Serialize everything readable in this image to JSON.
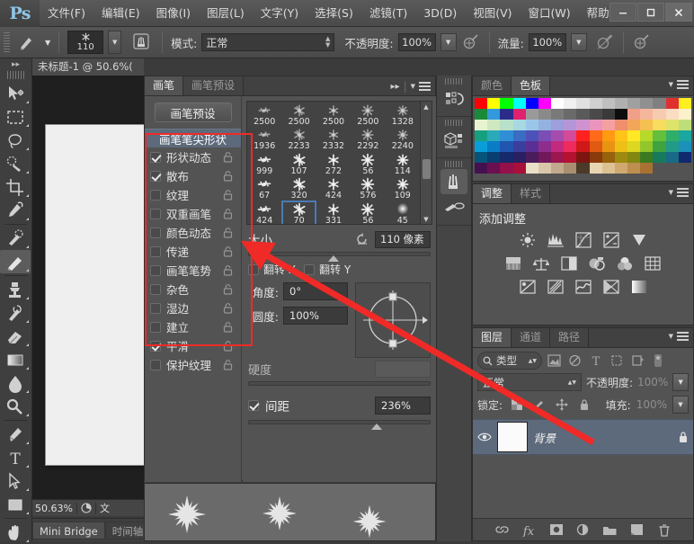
{
  "app": {
    "logo": "Ps",
    "menus": [
      "文件(F)",
      "编辑(E)",
      "图像(I)",
      "图层(L)",
      "文字(Y)",
      "选择(S)",
      "滤镜(T)",
      "3D(D)",
      "视图(V)",
      "窗口(W)",
      "帮助(H)"
    ],
    "window_buttons": {
      "minimize": "—",
      "maximize": "▢",
      "close": "✕"
    }
  },
  "options_bar": {
    "brush_preset_icon": "brush-preset-icon",
    "brush_size_value": "110",
    "airbrush_toggle_icon": "airbrush-toggle-icon",
    "mode_label": "模式:",
    "mode_value": "正常",
    "opacity_label": "不透明度:",
    "opacity_value": "100%",
    "opacity_pressure_icon": "opacity-pressure-icon",
    "flow_label": "流量:",
    "flow_value": "100%",
    "airbrush_icon": "airbrush-icon",
    "flow_pressure_icon": "flow-pressure-icon"
  },
  "toolbar": {
    "expand_icon": "double-chevron-right-icon",
    "tools": [
      {
        "name": "move-tool",
        "selected": false
      },
      {
        "name": "rectangular-marquee-tool",
        "selected": false
      },
      {
        "name": "lasso-tool",
        "selected": false
      },
      {
        "name": "quick-selection-tool",
        "selected": false
      },
      {
        "name": "crop-tool",
        "selected": false
      },
      {
        "name": "eyedropper-tool",
        "selected": false
      },
      {
        "name": "spot-healing-brush-tool",
        "selected": false
      },
      {
        "name": "brush-tool",
        "selected": true
      },
      {
        "name": "clone-stamp-tool",
        "selected": false
      },
      {
        "name": "history-brush-tool",
        "selected": false
      },
      {
        "name": "eraser-tool",
        "selected": false
      },
      {
        "name": "gradient-tool",
        "selected": false
      },
      {
        "name": "blur-tool",
        "selected": false
      },
      {
        "name": "dodge-tool",
        "selected": false
      },
      {
        "name": "pen-tool",
        "selected": false
      },
      {
        "name": "type-tool",
        "selected": false
      },
      {
        "name": "path-selection-tool",
        "selected": false
      },
      {
        "name": "rectangle-tool",
        "selected": false
      },
      {
        "name": "hand-tool",
        "selected": false
      }
    ]
  },
  "document": {
    "tab_title": "未标题-1 @ 50.6%(",
    "zoom_status": "50.63%",
    "doc_info": "文"
  },
  "bottom_tabs": [
    {
      "label": "Mini Bridge",
      "active": true
    },
    {
      "label": "时间轴",
      "active": false
    }
  ],
  "brush_panel": {
    "tabs": [
      {
        "label": "画笔",
        "active": true
      },
      {
        "label": "画笔预设",
        "active": false
      }
    ],
    "collapse_icon": "double-chevron-right-icon",
    "menu_icon": "panel-menu-icon",
    "preset_button": "画笔预设",
    "tip_shape_row": "画笔笔尖形状",
    "options": [
      {
        "label": "形状动态",
        "checked": true,
        "lock": "lock-icon"
      },
      {
        "label": "散布",
        "checked": true,
        "lock": "lock-icon"
      },
      {
        "label": "纹理",
        "checked": false,
        "lock": "lock-icon"
      },
      {
        "label": "双重画笔",
        "checked": false,
        "lock": "lock-icon"
      },
      {
        "label": "颜色动态",
        "checked": false,
        "lock": "lock-icon"
      },
      {
        "label": "传递",
        "checked": false,
        "lock": "lock-icon"
      },
      {
        "label": "画笔笔势",
        "checked": false,
        "lock": "lock-icon"
      },
      {
        "label": "杂色",
        "checked": false,
        "lock": "lock-icon"
      },
      {
        "label": "湿边",
        "checked": false,
        "lock": "lock-icon"
      },
      {
        "label": "建立",
        "checked": false,
        "lock": "lock-icon"
      },
      {
        "label": "平滑",
        "checked": true,
        "lock": "lock-icon"
      },
      {
        "label": "保护纹理",
        "checked": false,
        "lock": "lock-icon"
      }
    ],
    "tips": [
      {
        "size": "2500",
        "selected": false
      },
      {
        "size": "2500",
        "selected": false
      },
      {
        "size": "2500",
        "selected": false
      },
      {
        "size": "2500",
        "selected": false
      },
      {
        "size": "1328",
        "selected": false
      },
      {
        "size": "1936",
        "selected": false
      },
      {
        "size": "2233",
        "selected": false
      },
      {
        "size": "2332",
        "selected": false
      },
      {
        "size": "2292",
        "selected": false
      },
      {
        "size": "2240",
        "selected": false
      },
      {
        "size": "999",
        "selected": false
      },
      {
        "size": "107",
        "selected": false
      },
      {
        "size": "272",
        "selected": false
      },
      {
        "size": "56",
        "selected": false
      },
      {
        "size": "114",
        "selected": false
      },
      {
        "size": "67",
        "selected": false
      },
      {
        "size": "320",
        "selected": false
      },
      {
        "size": "424",
        "selected": false
      },
      {
        "size": "576",
        "selected": false
      },
      {
        "size": "109",
        "selected": false
      },
      {
        "size": "424",
        "selected": false
      },
      {
        "size": "70",
        "selected": true
      },
      {
        "size": "331",
        "selected": false
      },
      {
        "size": "56",
        "selected": false
      },
      {
        "size": "45",
        "selected": false
      }
    ],
    "size_label": "大小",
    "size_reset_icon": "reset-icon",
    "size_value": "110 像素",
    "flip_x_label": "翻转 X",
    "flip_x_checked": false,
    "flip_y_label": "翻转 Y",
    "flip_y_checked": false,
    "angle_label": "角度:",
    "angle_value": "0°",
    "roundness_label": "圆度:",
    "roundness_value": "100%",
    "hardness_label": "硬度",
    "hardness_value": "",
    "spacing_label": "间距",
    "spacing_checked": true,
    "spacing_value": "236%"
  },
  "dock_strip": {
    "groups": [
      [
        {
          "name": "history-actions-icon",
          "selected": false
        }
      ],
      [
        {
          "name": "3d-properties-icon",
          "selected": false
        }
      ],
      [
        {
          "name": "brush-panel-icon",
          "selected": true
        },
        {
          "name": "brush-presets-icon",
          "selected": false
        }
      ]
    ]
  },
  "color_panel": {
    "tabs": [
      {
        "label": "颜色",
        "active": false
      },
      {
        "label": "色板",
        "active": true
      }
    ],
    "menu_icon": "panel-menu-icon",
    "swatch_rows": [
      [
        "#ff0000",
        "#ffff00",
        "#00ff00",
        "#00ffff",
        "#0000ff",
        "#ff00ff",
        "#ffffff",
        "#f0f0f0",
        "#e0e0e0",
        "#d0d0d0",
        "#c0c0c0",
        "#b0b0b0",
        "#a0a0a0",
        "#909090",
        "#808080",
        "#e03030",
        "#ffee20"
      ],
      [
        "#1a8a3a",
        "#3399dd",
        "#2b2b8a",
        "#e0216f",
        "#9a9a9a",
        "#8a8a8a",
        "#7a7a7a",
        "#6a6a6a",
        "#5a5a5a",
        "#4a4a4a",
        "#3a3a3a",
        "#0d0d0d",
        "#f0a088",
        "#f5b79c",
        "#f7cbb0",
        "#fadcc2",
        "#fdf0cc"
      ],
      [
        "#e8f3d0",
        "#cfe8bf",
        "#b9e0c8",
        "#a8d8e2",
        "#9cc6e8",
        "#93b2e0",
        "#9d9edb",
        "#b496d8",
        "#cf92cf",
        "#eb94bd",
        "#f4a0a0",
        "#ef8f6d",
        "#f2a65a",
        "#f6bf52",
        "#f8dc5e",
        "#dfe36a",
        "#bede7a"
      ],
      [
        "#17a080",
        "#2aa9b8",
        "#2f8fd6",
        "#3a6cc4",
        "#4e52b8",
        "#7a4eb5",
        "#a74cae",
        "#d44a9a",
        "#ff2020",
        "#ff6a18",
        "#ff9a12",
        "#ffc418",
        "#ffe825",
        "#b6d92a",
        "#63bf3c",
        "#2fae6a",
        "#1ba6a0"
      ],
      [
        "#0a9ed8",
        "#0b7cc8",
        "#2055b0",
        "#3a3f9e",
        "#5a2f95",
        "#8f2d8e",
        "#c22b7d",
        "#ef2a5c",
        "#d01818",
        "#e05a12",
        "#e89412",
        "#eec016",
        "#dcd821",
        "#93c62a",
        "#3fa33f",
        "#219a88",
        "#1b90b8"
      ],
      [
        "#07547a",
        "#0a3d70",
        "#16296a",
        "#2a1f63",
        "#4a1c5c",
        "#73185a",
        "#9c1650",
        "#b41230",
        "#7d1410",
        "#8a3a0c",
        "#96620c",
        "#9e8a10",
        "#80880f",
        "#3c7a22",
        "#177a5a",
        "#186a86",
        "#102a6e"
      ],
      [
        "#45104f",
        "#6a1050",
        "#93104a",
        "#a8103a",
        "#eadfc8",
        "#d9c6ab",
        "#c0a98c",
        "#a98f70",
        "#4a3a28",
        "#e8d6b2",
        "#dcc193",
        "#cfa96f",
        "#bd8f4e",
        "#a87232",
        "",
        "",
        "",
        ""
      ]
    ]
  },
  "adjust_panel": {
    "tabs": [
      {
        "label": "调整",
        "active": true
      },
      {
        "label": "样式",
        "active": false
      }
    ],
    "menu_icon": "panel-menu-icon",
    "title": "添加调整",
    "rows": [
      [
        "brightness-contrast-icon",
        "levels-icon",
        "curves-icon",
        "exposure-icon",
        "vibrance-icon"
      ],
      [
        "hue-saturation-icon",
        "color-balance-icon",
        "black-white-icon",
        "photo-filter-icon",
        "channel-mixer-icon",
        "color-lookup-icon"
      ],
      [
        "invert-icon",
        "posterize-icon",
        "threshold-icon",
        "selective-color-icon",
        "gradient-map-icon"
      ]
    ]
  },
  "layers_panel": {
    "tabs": [
      {
        "label": "图层",
        "active": true
      },
      {
        "label": "通道",
        "active": false
      },
      {
        "label": "路径",
        "active": false
      }
    ],
    "menu_icon": "panel-menu-icon",
    "filter_label": "类型",
    "filter_icon": "search-icon",
    "filter_type_icons": [
      "pixel-filter-icon",
      "adjustment-filter-icon",
      "type-filter-icon",
      "shape-filter-icon",
      "smart-object-filter-icon"
    ],
    "filter_toggle_icon": "filter-toggle-icon",
    "blend_mode": "正常",
    "opacity_label": "不透明度:",
    "opacity_value": "100%",
    "lock_label": "锁定:",
    "lock_icons": [
      "lock-transparent-icon",
      "lock-image-icon",
      "lock-position-icon",
      "lock-all-icon"
    ],
    "fill_label": "填充:",
    "fill_value": "100%",
    "layers": [
      {
        "name": "背景",
        "visible": true,
        "locked": true,
        "visibility_icon": "eye-icon",
        "lock_icon": "lock-icon"
      }
    ],
    "footer_icons": [
      "link-layers-icon",
      "layer-style-icon",
      "layer-mask-icon",
      "new-adjustment-layer-icon",
      "new-group-icon",
      "new-layer-icon",
      "delete-layer-icon"
    ]
  },
  "annotations": {
    "highlight_box": "red-highlight-rectangle",
    "arrow": "red-arrow-pointing-to-size-slider",
    "accent_color": "#ef2a27"
  }
}
